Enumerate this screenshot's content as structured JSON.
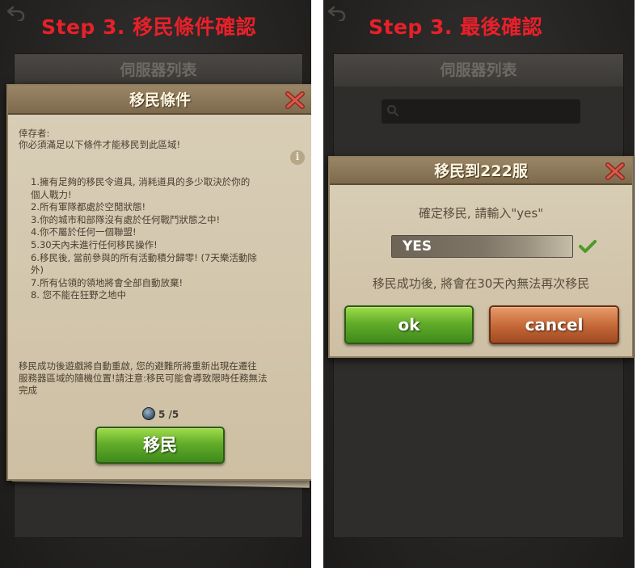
{
  "left": {
    "step_title": "Step 3. 移民條件確認",
    "server_list_title": "伺服器列表",
    "dialog": {
      "title": "移民條件",
      "greeting_1": "倖存者:",
      "greeting_2": "你必須滿足以下條件才能移民到此區域!",
      "conditions": [
        "1.擁有足夠的移民令道具, 消耗道具的多少取決於你的",
        "個人戰力!",
        "2.所有軍隊都處於空閒狀態!",
        "3.你的城市和部隊沒有處於任何戰鬥狀態之中!",
        "4.你不屬於任何一個聯盟!",
        "5.30天內未進行任何移民操作!",
        "6.移民後, 當前參與的所有活動積分歸零! (7天樂活動除",
        "外)",
        "7.所有佔領的領地將會全部自動放棄!",
        "8. 您不能在狂野之地中"
      ],
      "notice_lines": [
        "移民成功後遊戲將自動重啟, 您的避難所將重新出現在遷往",
        "服務器區域的隨機位置!請注意:移民可能會導致限時任務無法",
        "完成"
      ],
      "token_count": "5 /5",
      "migrate_button": "移民",
      "info_icon": "i"
    }
  },
  "right": {
    "step_title": "Step 3. 最後確認",
    "server_list_title": "伺服器列表",
    "dialog": {
      "title": "移民到222服",
      "prompt": "確定移民, 請輸入\"yes\"",
      "input_value": "YES",
      "warning": "移民成功後, 將會在30天內無法再次移民",
      "ok_button": "ok",
      "cancel_button": "cancel"
    }
  },
  "colors": {
    "step_title": "#e8202a",
    "green_button": "#5aa528",
    "orange_button": "#c86a3a",
    "parchment": "#d6cab1"
  }
}
